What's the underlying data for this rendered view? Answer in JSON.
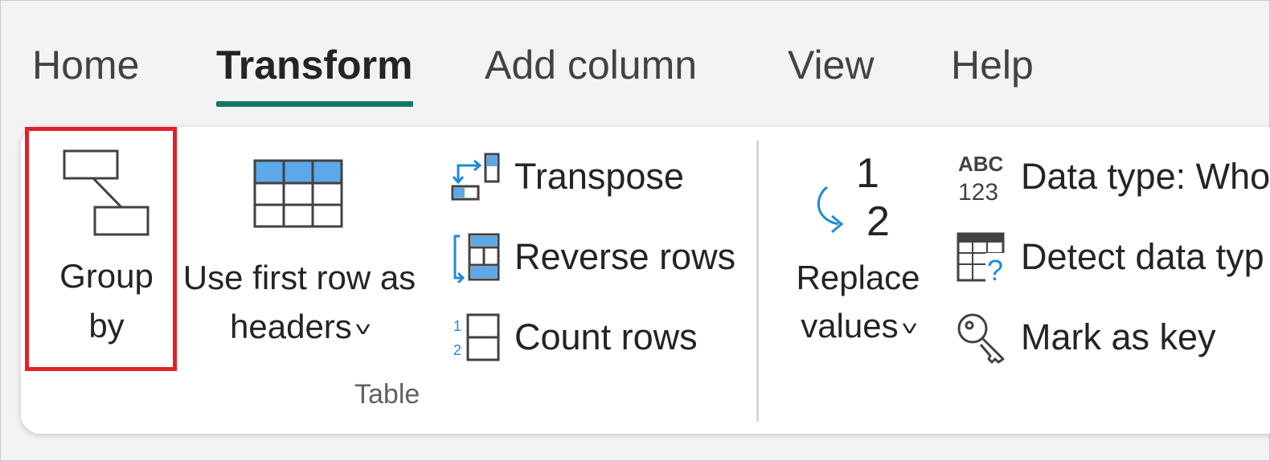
{
  "tabs": [
    {
      "label": "Home",
      "active": false
    },
    {
      "label": "Transform",
      "active": true
    },
    {
      "label": "Add column",
      "active": false
    },
    {
      "label": "View",
      "active": false
    },
    {
      "label": "Help",
      "active": false
    }
  ],
  "accent_color": "#117865",
  "highlight_color": "#e3212b",
  "ribbon": {
    "table_group": {
      "label": "Table",
      "group_by": {
        "line1": "Group",
        "line2": "by",
        "icon": "group-by-icon"
      },
      "use_first_row": {
        "line1": "Use first row as",
        "line2": "headers",
        "icon": "table-headers-icon"
      },
      "transpose": {
        "label": "Transpose",
        "icon": "transpose-icon"
      },
      "reverse_rows": {
        "label": "Reverse rows",
        "icon": "reverse-rows-icon"
      },
      "count_rows": {
        "label": "Count rows",
        "icon": "count-rows-icon"
      }
    },
    "any_column_group": {
      "replace_values": {
        "line1": "Replace",
        "line2": "values",
        "icon": "replace-values-icon"
      },
      "data_type": {
        "label": "Data type: Who",
        "icon": "abc-123-icon"
      },
      "detect_data_type": {
        "label": "Detect data typ",
        "icon": "detect-data-type-icon"
      },
      "mark_as_key": {
        "label": "Mark as key",
        "icon": "key-icon"
      }
    }
  }
}
